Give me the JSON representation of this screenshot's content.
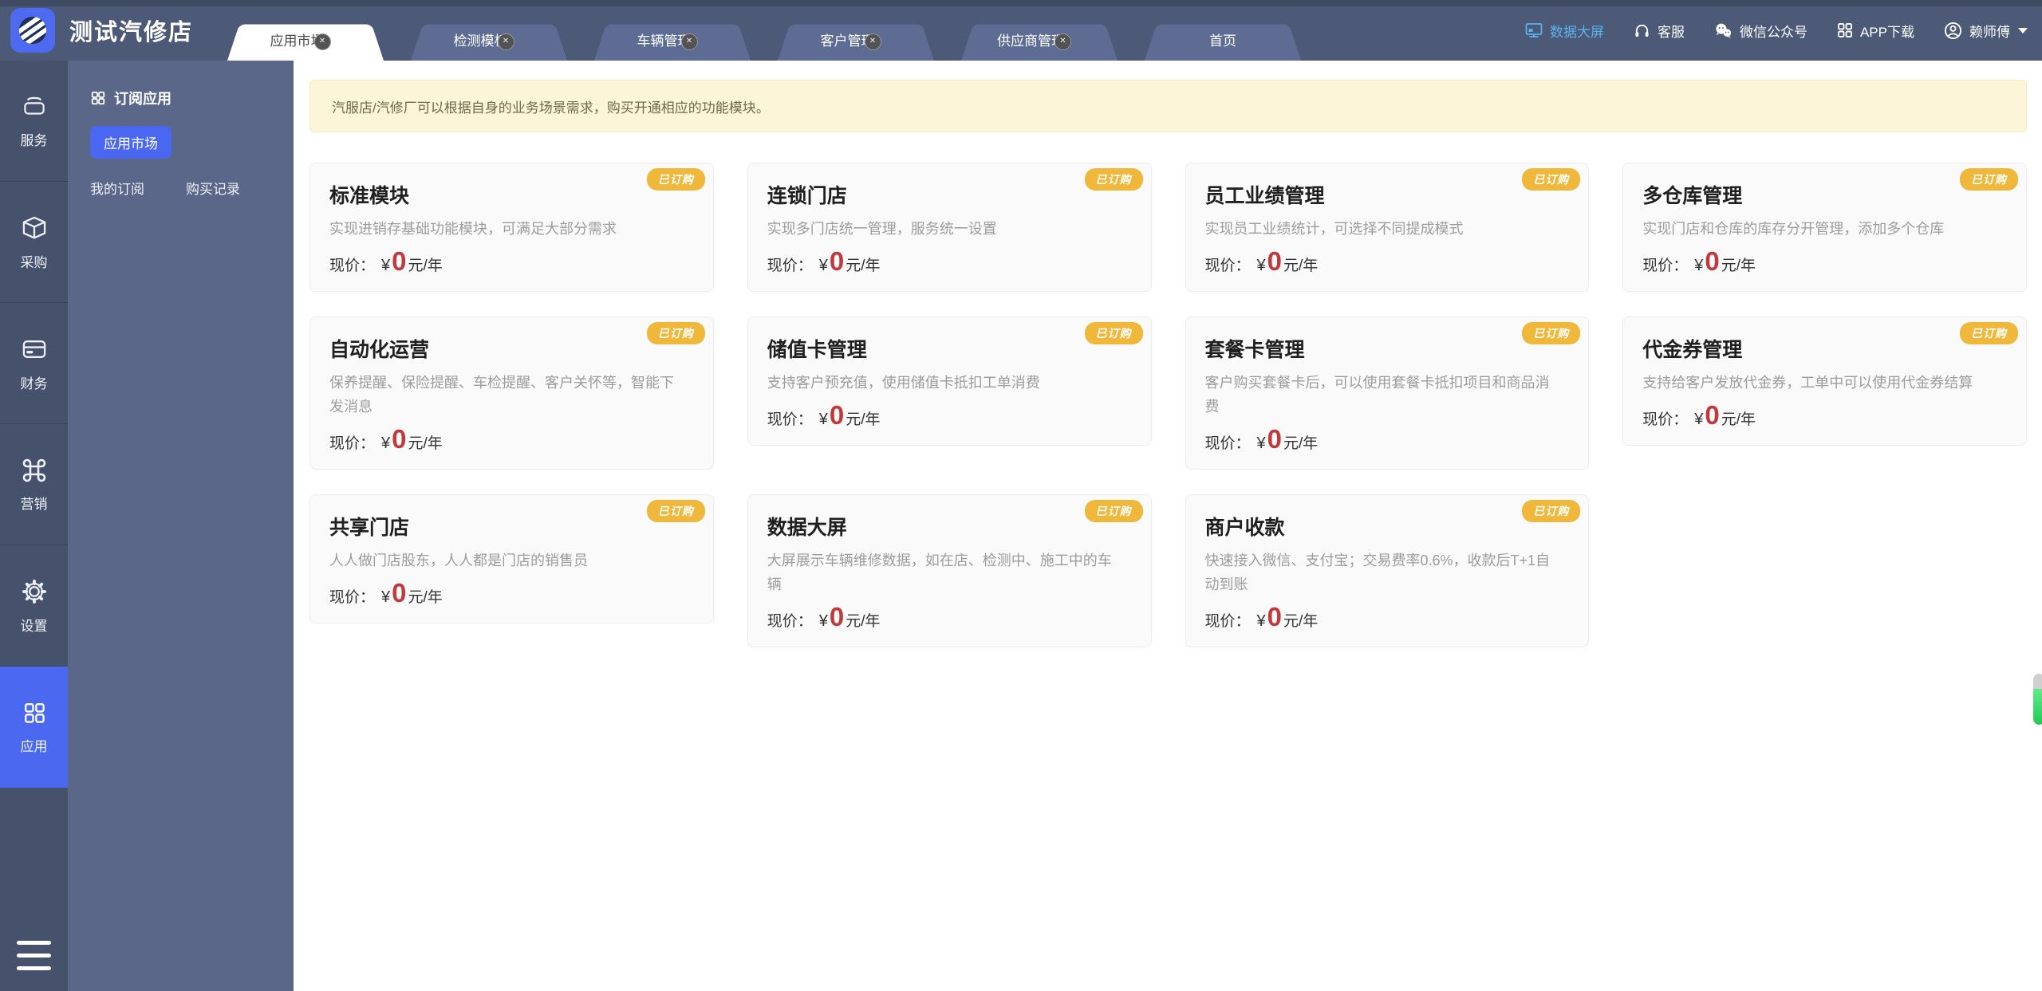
{
  "app": {
    "title": "测试汽修店"
  },
  "colors": {
    "header_bg": "#4c5977",
    "rail_bg": "#46516c",
    "side_bg": "#5a6789",
    "tab_bg": "#5e6c94",
    "accent_blue": "#4a67f2",
    "active_nav_blue": "#4b68f0",
    "badge_gold": "#efb83b",
    "price_red": "#c2393d",
    "notice_bg": "#fcf5d8",
    "data_screen_text": "#58b2ef"
  },
  "header": {
    "close_glyph": "✕",
    "tabs": [
      {
        "label": "应用市场",
        "active": true,
        "closable": true
      },
      {
        "label": "检测模板",
        "active": false,
        "closable": true
      },
      {
        "label": "车辆管理",
        "active": false,
        "closable": true
      },
      {
        "label": "客户管理",
        "active": false,
        "closable": true
      },
      {
        "label": "供应商管理",
        "active": false,
        "closable": true
      },
      {
        "label": "首页",
        "active": false,
        "closable": false
      }
    ],
    "actions": [
      {
        "label": "数据大屏",
        "icon": "monitor-icon"
      },
      {
        "label": "客服",
        "icon": "headset-icon"
      },
      {
        "label": "微信公众号",
        "icon": "wechat-icon"
      },
      {
        "label": "APP下载",
        "icon": "grid-icon"
      },
      {
        "label": "赖师傅",
        "icon": "user-icon",
        "dropdown": true
      }
    ]
  },
  "nav": {
    "items": [
      {
        "label": "服务",
        "icon": "service-icon",
        "active": false
      },
      {
        "label": "采购",
        "icon": "purchase-box-icon",
        "active": false
      },
      {
        "label": "财务",
        "icon": "finance-card-icon",
        "active": false
      },
      {
        "label": "营销",
        "icon": "marketing-command-icon",
        "active": false
      },
      {
        "label": "设置",
        "icon": "settings-gear-icon",
        "active": false
      },
      {
        "label": "应用",
        "icon": "apps-grid-icon",
        "active": true
      }
    ]
  },
  "sidebar": {
    "section_title": "订阅应用",
    "active_item": "应用市场",
    "links": [
      {
        "label": "我的订阅"
      },
      {
        "label": "购买记录"
      }
    ]
  },
  "main": {
    "notice": "汽服店/汽修厂可以根据自身的业务场景需求，购买开通相应的功能模块。",
    "badge_label": "已订购",
    "price_label": "现价：",
    "currency": "¥",
    "price_unit": "元/年",
    "cards": [
      {
        "title": "标准模块",
        "desc": "实现进销存基础功能模块，可满足大部分需求",
        "price": "0"
      },
      {
        "title": "连锁门店",
        "desc": "实现多门店统一管理，服务统一设置",
        "price": "0"
      },
      {
        "title": "员工业绩管理",
        "desc": "实现员工业绩统计，可选择不同提成模式",
        "price": "0"
      },
      {
        "title": "多仓库管理",
        "desc": "实现门店和仓库的库存分开管理，添加多个仓库",
        "price": "0"
      },
      {
        "title": "自动化运营",
        "desc": "保养提醒、保险提醒、车检提醒、客户关怀等，智能下发消息",
        "price": "0"
      },
      {
        "title": "储值卡管理",
        "desc": "支持客户预充值，使用储值卡抵扣工单消费",
        "price": "0"
      },
      {
        "title": "套餐卡管理",
        "desc": "客户购买套餐卡后，可以使用套餐卡抵扣项目和商品消费",
        "price": "0"
      },
      {
        "title": "代金券管理",
        "desc": "支持给客户发放代金券，工单中可以使用代金券结算",
        "price": "0"
      },
      {
        "title": "共享门店",
        "desc": "人人做门店股东，人人都是门店的销售员",
        "price": "0"
      },
      {
        "title": "数据大屏",
        "desc": "大屏展示车辆维修数据，如在店、检测中、施工中的车辆",
        "price": "0"
      },
      {
        "title": "商户收款",
        "desc": "快速接入微信、支付宝；交易费率0.6%，收款后T+1自动到账",
        "price": "0"
      }
    ]
  }
}
